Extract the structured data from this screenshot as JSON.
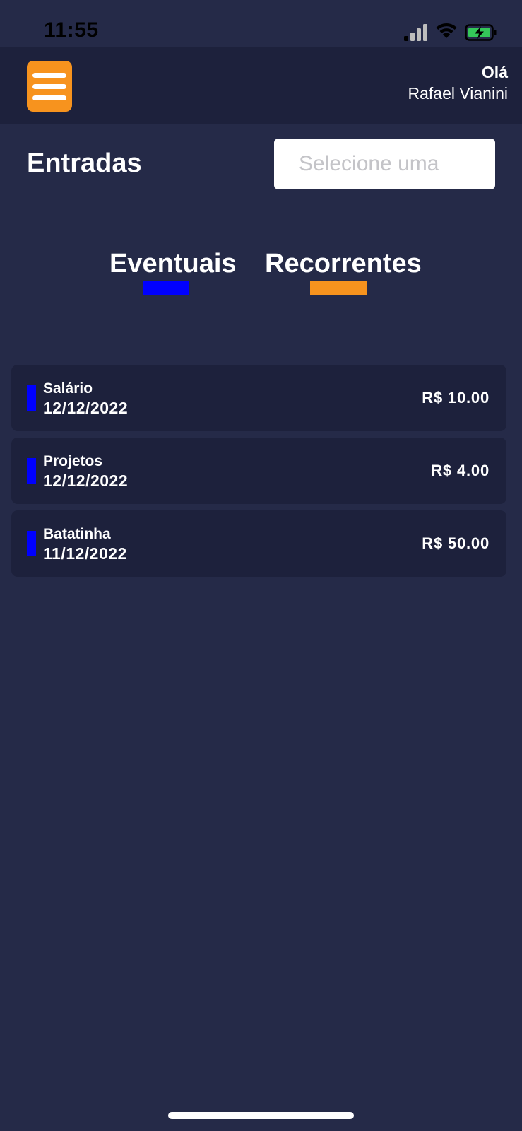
{
  "status_bar": {
    "time": "11:55",
    "icons": [
      "signal-icon",
      "wifi-icon",
      "battery-charging-icon"
    ]
  },
  "header": {
    "greeting": "Olá",
    "user_name": "Rafael Vianini",
    "menu_icon": "hamburger-menu-icon"
  },
  "page": {
    "title": "Entradas",
    "select_placeholder": "Selecione uma"
  },
  "tabs": [
    {
      "label": "Eventuais",
      "color": "#0000FF"
    },
    {
      "label": "Recorrentes",
      "color": "#F7931E"
    }
  ],
  "entries": [
    {
      "name": "Salário",
      "date": "12/12/2022",
      "amount": "R$ 10.00",
      "color": "#0000FF"
    },
    {
      "name": "Projetos",
      "date": "12/12/2022",
      "amount": "R$ 4.00",
      "color": "#0000FF"
    },
    {
      "name": "Batatinha",
      "date": "11/12/2022",
      "amount": "R$ 50.00",
      "color": "#0000FF"
    }
  ],
  "colors": {
    "background": "#252A48",
    "card": "#1D213C",
    "accent": "#F7931E",
    "eventual": "#0000FF"
  }
}
